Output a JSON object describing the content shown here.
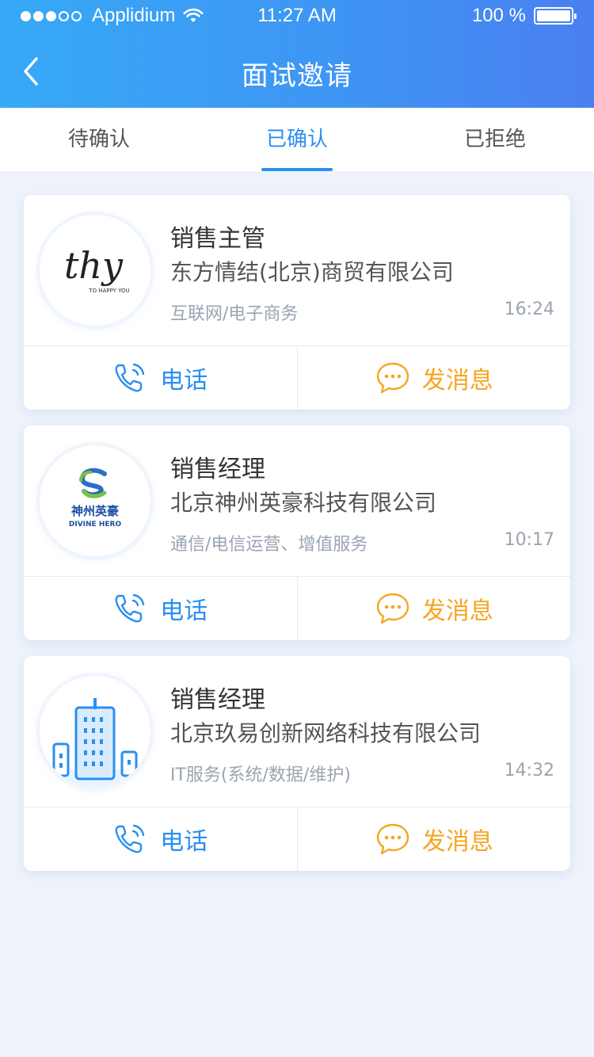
{
  "status_bar": {
    "carrier": "Applidium",
    "time": "11:27 AM",
    "battery": "100 %"
  },
  "header": {
    "title": "面试邀请",
    "back_icon": "chevron-left-icon"
  },
  "tabs": [
    {
      "label": "待确认",
      "active": false
    },
    {
      "label": "已确认",
      "active": true
    },
    {
      "label": "已拒绝",
      "active": false
    }
  ],
  "cards": [
    {
      "job_title": "销售主管",
      "company": "东方情结(北京)商贸有限公司",
      "industry": "互联网/电子商务",
      "time": "16:24",
      "logo_text": "thy",
      "logo_subtext": "TO HAPPY YOU",
      "call_label": "电话",
      "message_label": "发消息"
    },
    {
      "job_title": "销售经理",
      "company": "北京神州英豪科技有限公司",
      "industry": "通信/电信运营、增值服务",
      "time": "10:17",
      "logo_text": "神州英豪",
      "logo_subtext": "DIVINE HERO",
      "call_label": "电话",
      "message_label": "发消息"
    },
    {
      "job_title": "销售经理",
      "company": "北京玖易创新网络科技有限公司",
      "industry": "IT服务(系统/数据/维护)",
      "time": "14:32",
      "call_label": "电话",
      "message_label": "发消息"
    }
  ],
  "colors": {
    "accent": "#2a8ff0",
    "message": "#f5a623",
    "header_start": "#36a9f6",
    "header_end": "#4a7ff0"
  }
}
